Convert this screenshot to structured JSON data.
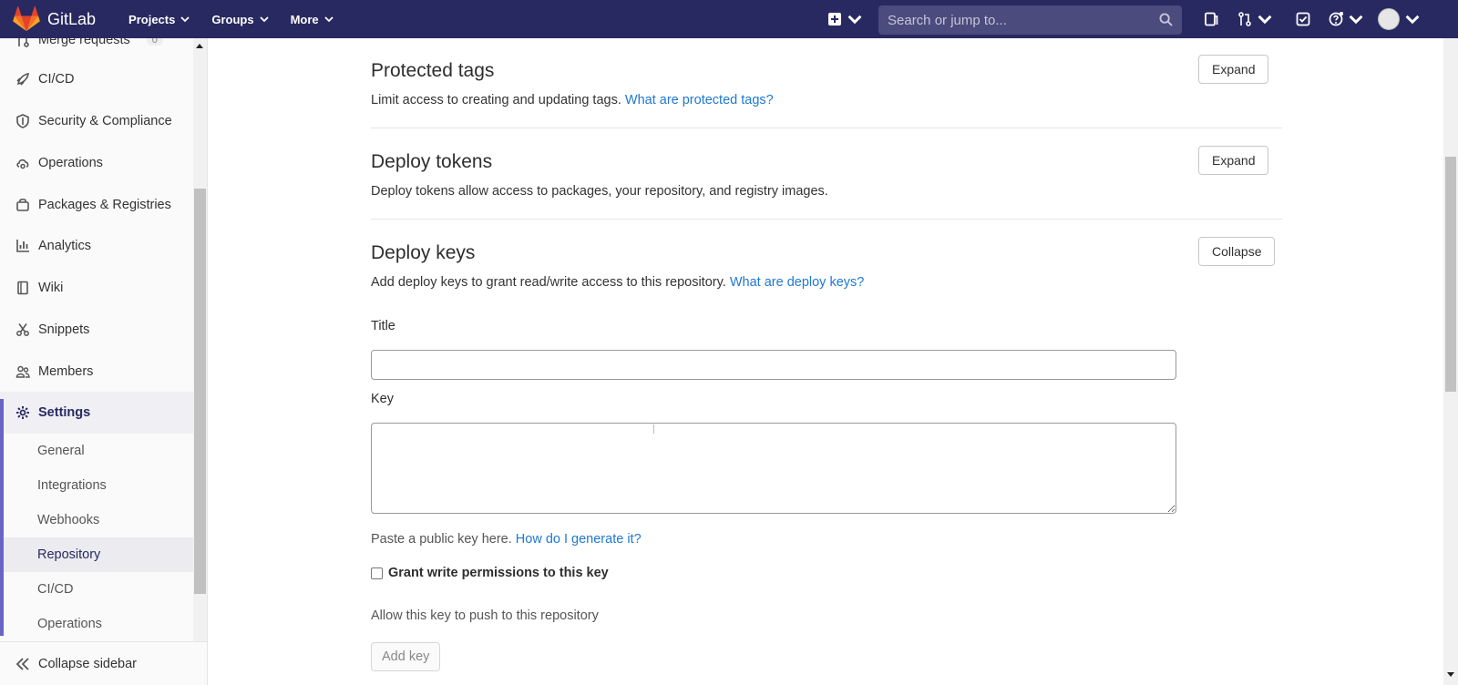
{
  "navbar": {
    "brand": "GitLab",
    "menu": [
      {
        "label": "Projects"
      },
      {
        "label": "Groups"
      },
      {
        "label": "More"
      }
    ],
    "search_placeholder": "Search or jump to..."
  },
  "sidebar": {
    "items": [
      {
        "label": "Merge requests",
        "badge": "0",
        "icon": "merge-request-icon"
      },
      {
        "label": "CI/CD",
        "icon": "rocket-icon"
      },
      {
        "label": "Security & Compliance",
        "icon": "shield-icon"
      },
      {
        "label": "Operations",
        "icon": "cloud-gear-icon"
      },
      {
        "label": "Packages & Registries",
        "icon": "package-icon"
      },
      {
        "label": "Analytics",
        "icon": "chart-icon"
      },
      {
        "label": "Wiki",
        "icon": "book-icon"
      },
      {
        "label": "Snippets",
        "icon": "scissors-icon"
      },
      {
        "label": "Members",
        "icon": "users-icon"
      },
      {
        "label": "Settings",
        "icon": "gear-icon"
      }
    ],
    "sub_items": [
      {
        "label": "General"
      },
      {
        "label": "Integrations"
      },
      {
        "label": "Webhooks"
      },
      {
        "label": "Repository"
      },
      {
        "label": "CI/CD"
      },
      {
        "label": "Operations"
      }
    ],
    "collapse_label": "Collapse sidebar"
  },
  "sections": {
    "protected_tags": {
      "title": "Protected tags",
      "desc": "Limit access to creating and updating tags.",
      "link": "What are protected tags?",
      "button": "Expand"
    },
    "deploy_tokens": {
      "title": "Deploy tokens",
      "desc": "Deploy tokens allow access to packages, your repository, and registry images.",
      "button": "Expand"
    },
    "deploy_keys": {
      "title": "Deploy keys",
      "desc": "Add deploy keys to grant read/write access to this repository.",
      "link": "What are deploy keys?",
      "button": "Collapse",
      "title_label": "Title",
      "title_value": "",
      "key_label": "Key",
      "key_value": "",
      "key_help": "Paste a public key here.",
      "key_help_link": "How do I generate it?",
      "grant_label": "Grant write permissions to this key",
      "grant_help": "Allow this key to push to this repository",
      "submit": "Add key"
    }
  },
  "colors": {
    "navbar_bg": "#292961",
    "link": "#1f78d1",
    "active": "#292961"
  }
}
